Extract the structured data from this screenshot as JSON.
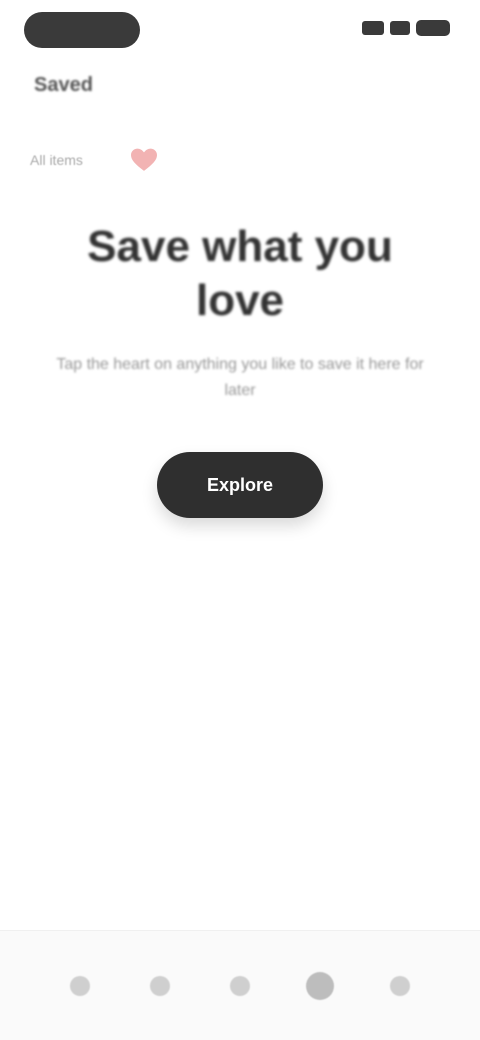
{
  "status_bar": {
    "pill_label": "",
    "icons": [
      "signal-icon",
      "wifi-icon",
      "battery-icon"
    ]
  },
  "header": {
    "title": "Saved"
  },
  "tabs": [
    {
      "label": "All items",
      "active": false
    },
    {
      "label": "",
      "active": true,
      "icon": "heart-icon"
    }
  ],
  "empty_state": {
    "title": "Save what you love",
    "subtitle": "Tap the heart on anything you like to save it here for later",
    "cta_label": "Explore"
  },
  "bottom_nav": {
    "items": [
      {
        "icon": "home-icon"
      },
      {
        "icon": "search-icon"
      },
      {
        "icon": "add-icon"
      },
      {
        "icon": "saved-icon",
        "active": true
      },
      {
        "icon": "profile-icon"
      }
    ]
  },
  "colors": {
    "accent": "#e06060",
    "button": "#2f2f2f",
    "background": "#ffffff"
  }
}
